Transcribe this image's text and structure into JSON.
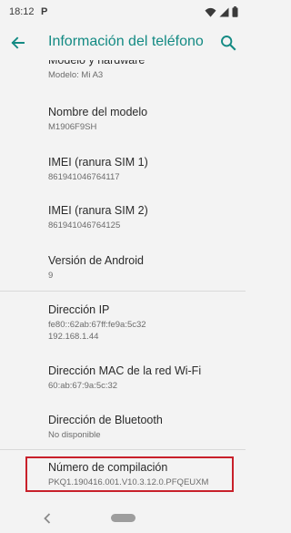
{
  "status_bar": {
    "time": "18:12",
    "notification_letter": "P",
    "icons": [
      "wifi-icon",
      "cellular-signal-icon",
      "battery-icon"
    ]
  },
  "app_bar": {
    "title": "Información del teléfono",
    "accent_color": "#138a83",
    "icons": [
      "back-arrow-icon",
      "search-icon"
    ]
  },
  "rows": [
    {
      "title": "Modelo y hardware",
      "value": "Modelo: Mi A3"
    },
    {
      "title": "Nombre del modelo",
      "value": "M1906F9SH"
    },
    {
      "title": "IMEI (ranura SIM 1)",
      "value": "861941046764117"
    },
    {
      "title": "IMEI (ranura SIM 2)",
      "value": "861941046764125"
    },
    {
      "title": "Versión de Android",
      "value": "9"
    },
    {
      "title": "Dirección IP",
      "value": "fe80::62ab:67ff:fe9a:5c32",
      "value2": "192.168.1.44"
    },
    {
      "title": "Dirección MAC de la red Wi-Fi",
      "value": "60:ab:67:9a:5c:32"
    },
    {
      "title": "Dirección de Bluetooth",
      "value": "No disponible"
    },
    {
      "title": "Número de compilación",
      "value": "PKQ1.190416.001.V10.3.12.0.PFQEUXM"
    }
  ],
  "highlight": {
    "target": "Número de compilación",
    "color": "#c8202a"
  },
  "nav_bar": {
    "icons": [
      "nav-back-icon",
      "home-pill"
    ]
  }
}
